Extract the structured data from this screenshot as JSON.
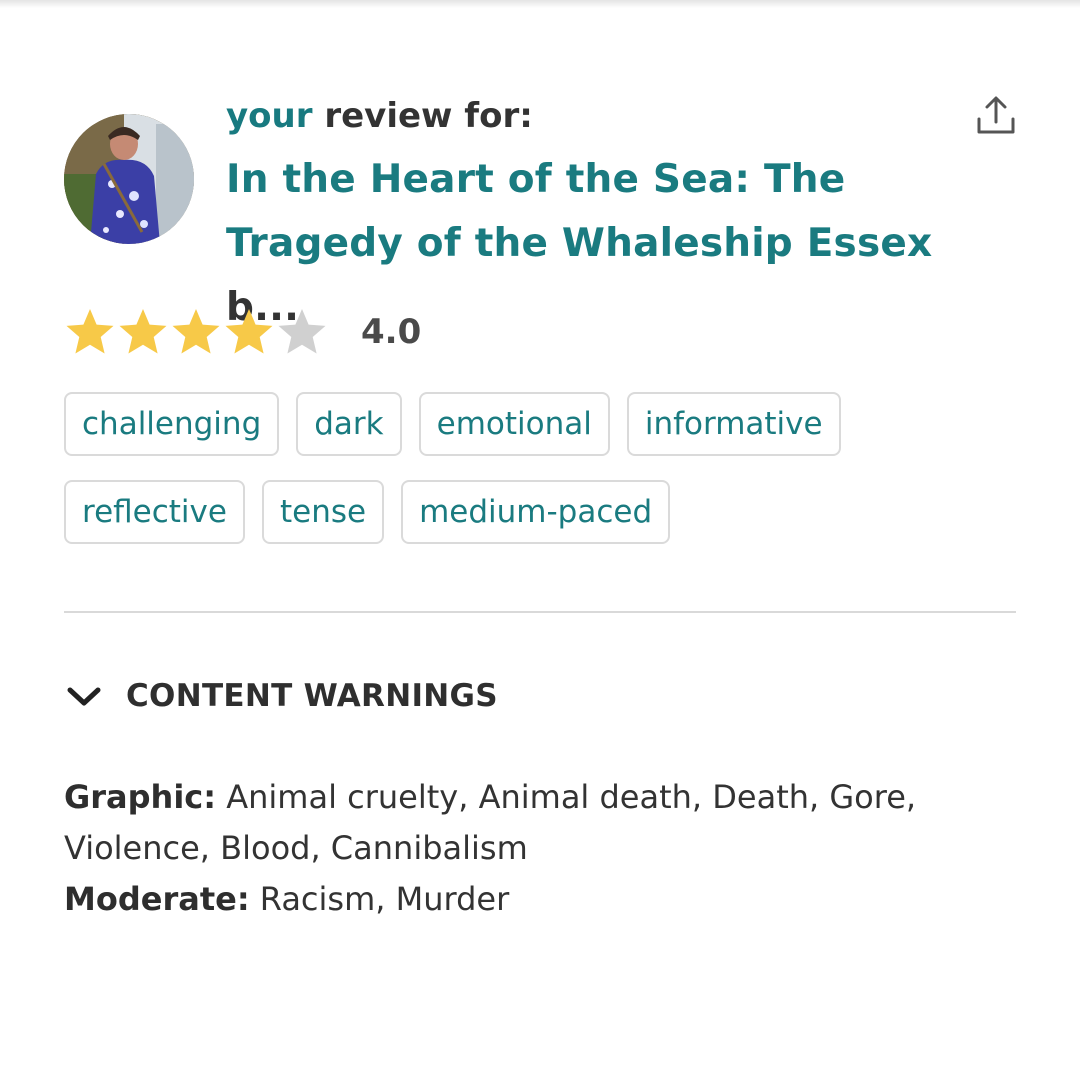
{
  "header": {
    "review_prefix": "your",
    "review_suffix": "review for:",
    "book_title": "In the Heart of the Sea: The Tragedy of the Whaleship Essex",
    "by_truncated": "b..."
  },
  "icons": {
    "share": "share-upload-icon",
    "star": "star-icon",
    "chevron": "chevron-down-icon"
  },
  "rating": {
    "stars_filled": 4,
    "stars_total": 5,
    "value": "4.0"
  },
  "tags": {
    "row1": [
      "challenging",
      "dark",
      "emotional",
      "informative"
    ],
    "row2": [
      "reflective",
      "tense",
      "medium-paced"
    ]
  },
  "content_warnings": {
    "title": "CONTENT WARNINGS",
    "graphic_label": "Graphic:",
    "graphic_text": "Animal cruelty, Animal death, Death, Gore, Violence, Blood, Cannibalism",
    "moderate_label": "Moderate:",
    "moderate_text": "Racism, Murder"
  },
  "colors": {
    "accent": "#1a7b80",
    "star_filled": "#f7c948",
    "star_empty": "#d0d0d0",
    "tag_border": "#dadada"
  }
}
